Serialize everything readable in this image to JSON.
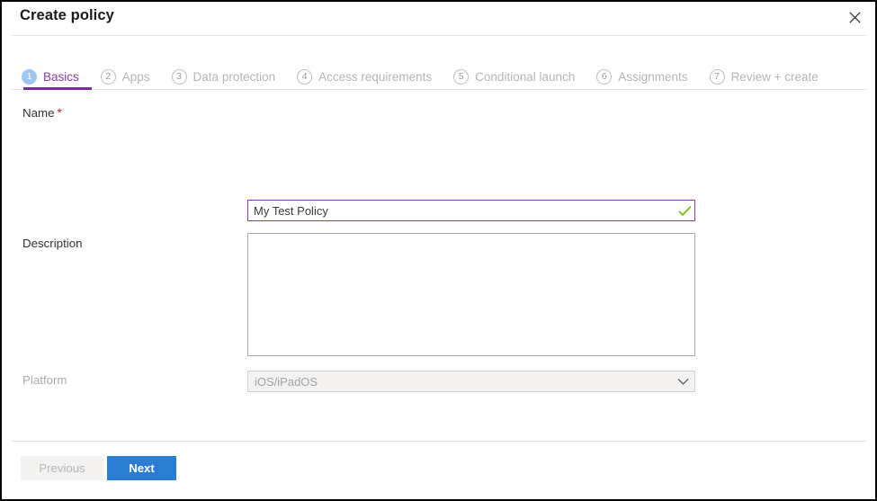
{
  "window": {
    "title": "Create policy",
    "close_icon": "close-icon"
  },
  "tabs": [
    {
      "number": "1",
      "label": "Basics",
      "active": true
    },
    {
      "number": "2",
      "label": "Apps",
      "active": false
    },
    {
      "number": "3",
      "label": "Data protection",
      "active": false
    },
    {
      "number": "4",
      "label": "Access requirements",
      "active": false
    },
    {
      "number": "5",
      "label": "Conditional launch",
      "active": false
    },
    {
      "number": "6",
      "label": "Assignments",
      "active": false
    },
    {
      "number": "7",
      "label": "Review + create",
      "active": false
    }
  ],
  "form": {
    "name": {
      "label": "Name",
      "required_marker": "*",
      "value": "My Test Policy",
      "placeholder": "",
      "valid_icon": "checkmark-icon"
    },
    "description": {
      "label": "Description",
      "value": "",
      "placeholder": ""
    },
    "platform": {
      "label": "Platform",
      "value": "iOS/iPadOS",
      "disabled": true,
      "chevron_icon": "chevron-down-icon"
    }
  },
  "footer": {
    "previous_label": "Previous",
    "next_label": "Next"
  },
  "colors": {
    "accent_purple": "#7b2d9e",
    "tab_active_text": "#8a3ab0",
    "focus_border": "#8a3ab0",
    "valid_green": "#6bb700",
    "primary_blue": "#2b7cd3",
    "required_red": "#a4262c",
    "disabled_bg": "#f3f2f1",
    "disabled_text": "#a9a9a9"
  }
}
